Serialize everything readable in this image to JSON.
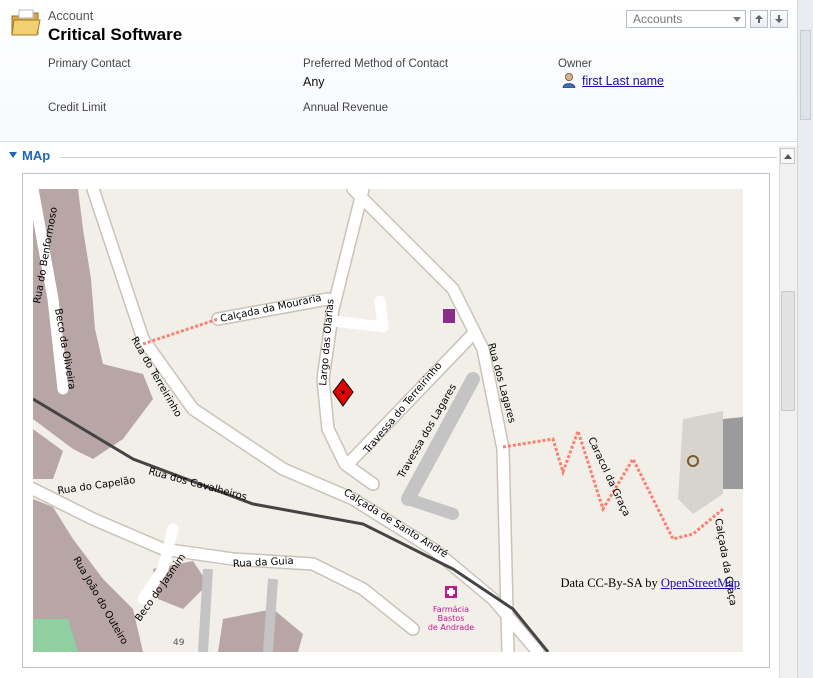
{
  "header": {
    "entity_label": "Account",
    "record_title": "Critical Software",
    "entity_select": {
      "selected": "Accounts"
    }
  },
  "fields": {
    "primary_contact": {
      "label": "Primary Contact",
      "value": ""
    },
    "preferred_contact": {
      "label": "Preferred Method of Contact",
      "value": "Any"
    },
    "owner": {
      "label": "Owner",
      "value": "first Last name"
    },
    "credit_limit": {
      "label": "Credit Limit",
      "value": ""
    },
    "annual_revenue": {
      "label": "Annual Revenue",
      "value": ""
    }
  },
  "section": {
    "title": "MAp"
  },
  "map": {
    "attribution_prefix": "Data CC-By-SA by ",
    "attribution_link": "OpenStreetMap",
    "street_labels": {
      "benformoso": "Rua do Benformoso",
      "oliveira": "Beco da Oliveira",
      "mouraria": "Calçada da Mouraria",
      "olarias": "Largo das Olarias",
      "terreirinho_rua": "Rua do Terreirinho",
      "terreirinho_trav": "Travessa do Terreirinho",
      "lagares_trav": "Travessa dos Lagares",
      "lagares_rua": "Rua dos Lagares",
      "caracol": "Caracol da Graça",
      "calcada_graca": "Calçada da Graça",
      "cavalheiros": "Rua dos Cavalheiros",
      "santo_andre": "Calçada de Santo André",
      "capelao": "Rua do Capelão",
      "guia": "Rua da Guia",
      "jasmim": "Beco do Jasmim",
      "outeiro": "Rua João do Outeiro"
    },
    "poi": {
      "line1": "Farmácia",
      "line2": "Bastos",
      "line3": "de Andrade"
    },
    "house_number": "49"
  },
  "colors": {
    "section_title": "#1f66b8",
    "road": "#ffffff",
    "land": "#f2efe9",
    "building": "#b8a6a6",
    "footpath": "#fa8072",
    "tram": "#444444",
    "pharmacy": "#c0188a",
    "marker": "#e00000"
  }
}
